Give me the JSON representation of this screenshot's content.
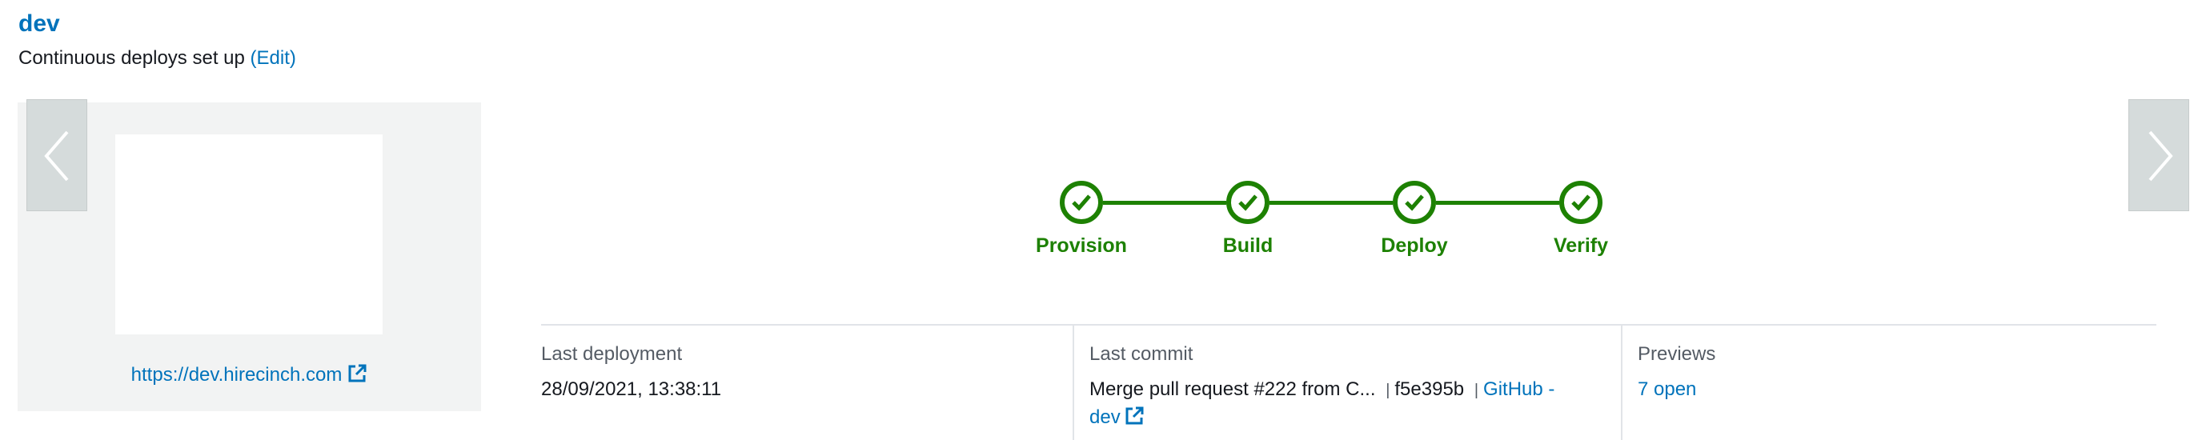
{
  "branch": {
    "name": "dev",
    "cd_text": "Continuous deploys set up",
    "edit_label": "(Edit)"
  },
  "preview": {
    "domain_url": "https://dev.hirecinch.com"
  },
  "pipeline": {
    "status_color": "#1d8102",
    "steps": [
      {
        "label": "Provision",
        "status": "succeeded"
      },
      {
        "label": "Build",
        "status": "succeeded"
      },
      {
        "label": "Deploy",
        "status": "succeeded"
      },
      {
        "label": "Verify",
        "status": "succeeded"
      }
    ]
  },
  "details": {
    "last_deployment": {
      "label": "Last deployment",
      "value": "28/09/2021, 13:38:11"
    },
    "last_commit": {
      "label": "Last commit",
      "message": "Merge pull request #222 from C...",
      "sep1": "|",
      "hash": "f5e395b",
      "sep2": "|",
      "repo_link": "GitHub - dev"
    },
    "previews": {
      "label": "Previews",
      "value": "7 open"
    }
  },
  "colors": {
    "link": "#0073bb",
    "success": "#1d8102",
    "panel_bg": "#f2f3f3"
  }
}
